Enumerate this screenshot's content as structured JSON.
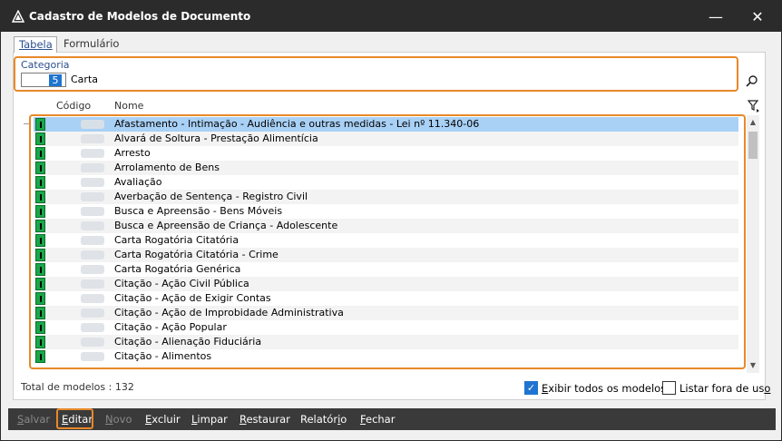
{
  "window": {
    "title": "Cadastro de Modelos de Documento",
    "min_glyph": "—",
    "close_glyph": "✕"
  },
  "tabs": [
    {
      "label": "Tabela",
      "active": true
    },
    {
      "label": "Formulário",
      "active": false
    }
  ],
  "categoria": {
    "label": "Categoria",
    "code": "5",
    "name": "Carta"
  },
  "grid": {
    "columns": [
      "Código",
      "Nome"
    ],
    "rows": [
      "Afastamento - Intimação - Audiência e outras medidas - Lei nº 11.340-06",
      "Alvará de Soltura - Prestação Alimentícia",
      "Arresto",
      "Arrolamento de Bens",
      "Avaliação",
      "Averbação de Sentença - Registro Civil",
      "Busca e Apreensão - Bens Móveis",
      "Busca e Apreensão de Criança - Adolescente",
      "Carta Rogatória Citatória",
      "Carta Rogatória Citatória - Crime",
      "Carta Rogatória Genérica",
      "Citação - Ação Civil Pública",
      "Citação - Ação de Exigir Contas",
      "Citação - Ação de Improbidade Administrativa",
      "Citação - Ação Popular",
      "Citação - Alienação Fiduciária",
      "Citação - Alimentos"
    ],
    "selected_index": 0
  },
  "footer": {
    "total": "Total de modelos : 132",
    "exibir_label": "Exibir todos os modelos",
    "exibir_checked": true,
    "listar_label": "Listar fora de uso",
    "listar_checked": false
  },
  "toolbar": {
    "salvar": "Salvar",
    "editar": "Editar",
    "novo": "Novo",
    "excluir": "Excluir",
    "limpar": "Limpar",
    "restaurar": "Restaurar",
    "relatorio": "Relatório",
    "fechar": "Fechar"
  },
  "colors": {
    "accent": "#1e74d0",
    "highlight": "#e8892a",
    "selected_row": "#a9d0f5",
    "row_icon": "#19a84a"
  },
  "icons": [
    "app-icon",
    "search-icon",
    "filter-icon",
    "document-icon"
  ]
}
